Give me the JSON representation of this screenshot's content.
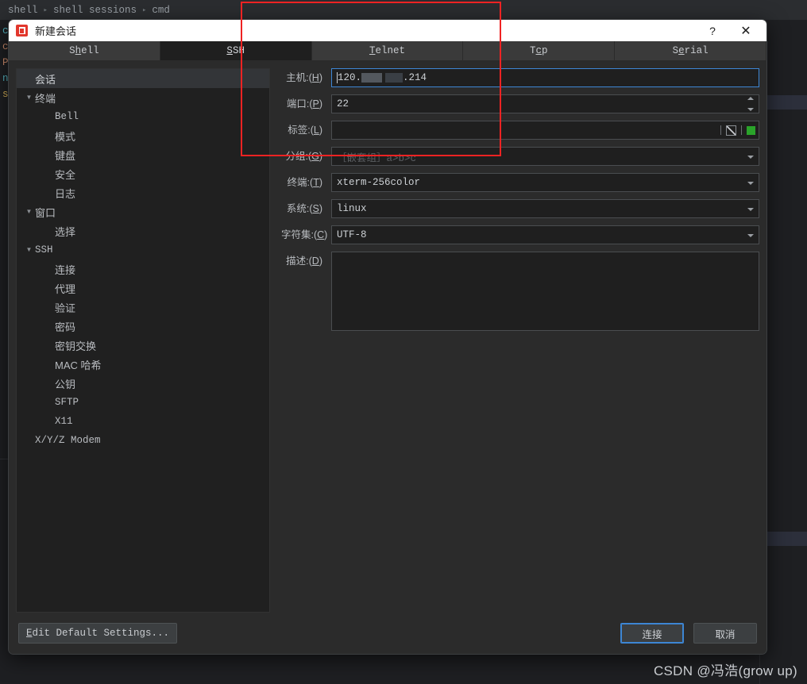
{
  "background": {
    "breadcrumb": [
      "shell",
      "shell sessions",
      "cmd"
    ],
    "terminal_lines": [
      "cl",
      "co",
      "Po",
      "nt",
      "",
      "s"
    ]
  },
  "dialog": {
    "title": "新建会话",
    "app_icon": "app-logo-icon",
    "help_label": "?",
    "close_label": "✕",
    "tabs": [
      {
        "label": "Shell",
        "mnemonic": "h",
        "active": false
      },
      {
        "label": "SSH",
        "mnemonic": "S",
        "active": true
      },
      {
        "label": "Telnet",
        "mnemonic": "T",
        "active": false
      },
      {
        "label": "Tcp",
        "mnemonic": "c",
        "active": false
      },
      {
        "label": "Serial",
        "mnemonic": "e",
        "active": false
      }
    ],
    "sidebar": [
      {
        "label": "会话",
        "level": 0,
        "arrow": "none",
        "selected": true,
        "mono": false
      },
      {
        "label": "终端",
        "level": 0,
        "arrow": "expanded",
        "selected": false,
        "mono": false
      },
      {
        "label": "Bell",
        "level": 1,
        "arrow": "none",
        "selected": false,
        "mono": true
      },
      {
        "label": "模式",
        "level": 1,
        "arrow": "none",
        "selected": false,
        "mono": false
      },
      {
        "label": "键盘",
        "level": 1,
        "arrow": "none",
        "selected": false,
        "mono": false
      },
      {
        "label": "安全",
        "level": 1,
        "arrow": "none",
        "selected": false,
        "mono": false
      },
      {
        "label": "日志",
        "level": 1,
        "arrow": "none",
        "selected": false,
        "mono": false
      },
      {
        "label": "窗口",
        "level": 0,
        "arrow": "expanded",
        "selected": false,
        "mono": false
      },
      {
        "label": "选择",
        "level": 1,
        "arrow": "none",
        "selected": false,
        "mono": false
      },
      {
        "label": "SSH",
        "level": 0,
        "arrow": "expanded",
        "selected": false,
        "mono": true
      },
      {
        "label": "连接",
        "level": 1,
        "arrow": "none",
        "selected": false,
        "mono": false
      },
      {
        "label": "代理",
        "level": 1,
        "arrow": "none",
        "selected": false,
        "mono": false
      },
      {
        "label": "验证",
        "level": 1,
        "arrow": "none",
        "selected": false,
        "mono": false
      },
      {
        "label": "密码",
        "level": 1,
        "arrow": "none",
        "selected": false,
        "mono": false
      },
      {
        "label": "密钥交换",
        "level": 1,
        "arrow": "none",
        "selected": false,
        "mono": false
      },
      {
        "label": "MAC 哈希",
        "level": 1,
        "arrow": "none",
        "selected": false,
        "mono": false
      },
      {
        "label": "公钥",
        "level": 1,
        "arrow": "none",
        "selected": false,
        "mono": false
      },
      {
        "label": "SFTP",
        "level": 1,
        "arrow": "none",
        "selected": false,
        "mono": true
      },
      {
        "label": "X11",
        "level": 1,
        "arrow": "none",
        "selected": false,
        "mono": true
      },
      {
        "label": "X/Y/Z Modem",
        "level": 0,
        "arrow": "none",
        "selected": false,
        "mono": true
      }
    ],
    "form": {
      "host": {
        "label": "主机:",
        "mnemonic": "H",
        "value_prefix": "120.",
        "value_suffix": ".214",
        "focused": true
      },
      "port": {
        "label": "端口:",
        "mnemonic": "P",
        "value": "22"
      },
      "tag": {
        "label": "标签:",
        "mnemonic": "L",
        "value": "",
        "swatch_color": "#2aa32a"
      },
      "group": {
        "label": "分组:",
        "mnemonic": "G",
        "value": "",
        "placeholder": "［嵌套组］a>b>c"
      },
      "terminal": {
        "label": "终端:",
        "mnemonic": "T",
        "value": "xterm-256color"
      },
      "system": {
        "label": "系统:",
        "mnemonic": "S",
        "value": "linux"
      },
      "charset": {
        "label": "字符集:",
        "mnemonic": "C",
        "value": "UTF-8"
      },
      "desc": {
        "label": "描述:",
        "mnemonic": "D",
        "value": ""
      }
    },
    "footer": {
      "edit_defaults_prefix": "E",
      "edit_defaults_label": "dit Default Settings...",
      "connect_label": "连接",
      "cancel_label": "取消"
    }
  },
  "annotation": {
    "color": "#ef2323"
  },
  "watermark": "CSDN @冯浩(grow up)"
}
